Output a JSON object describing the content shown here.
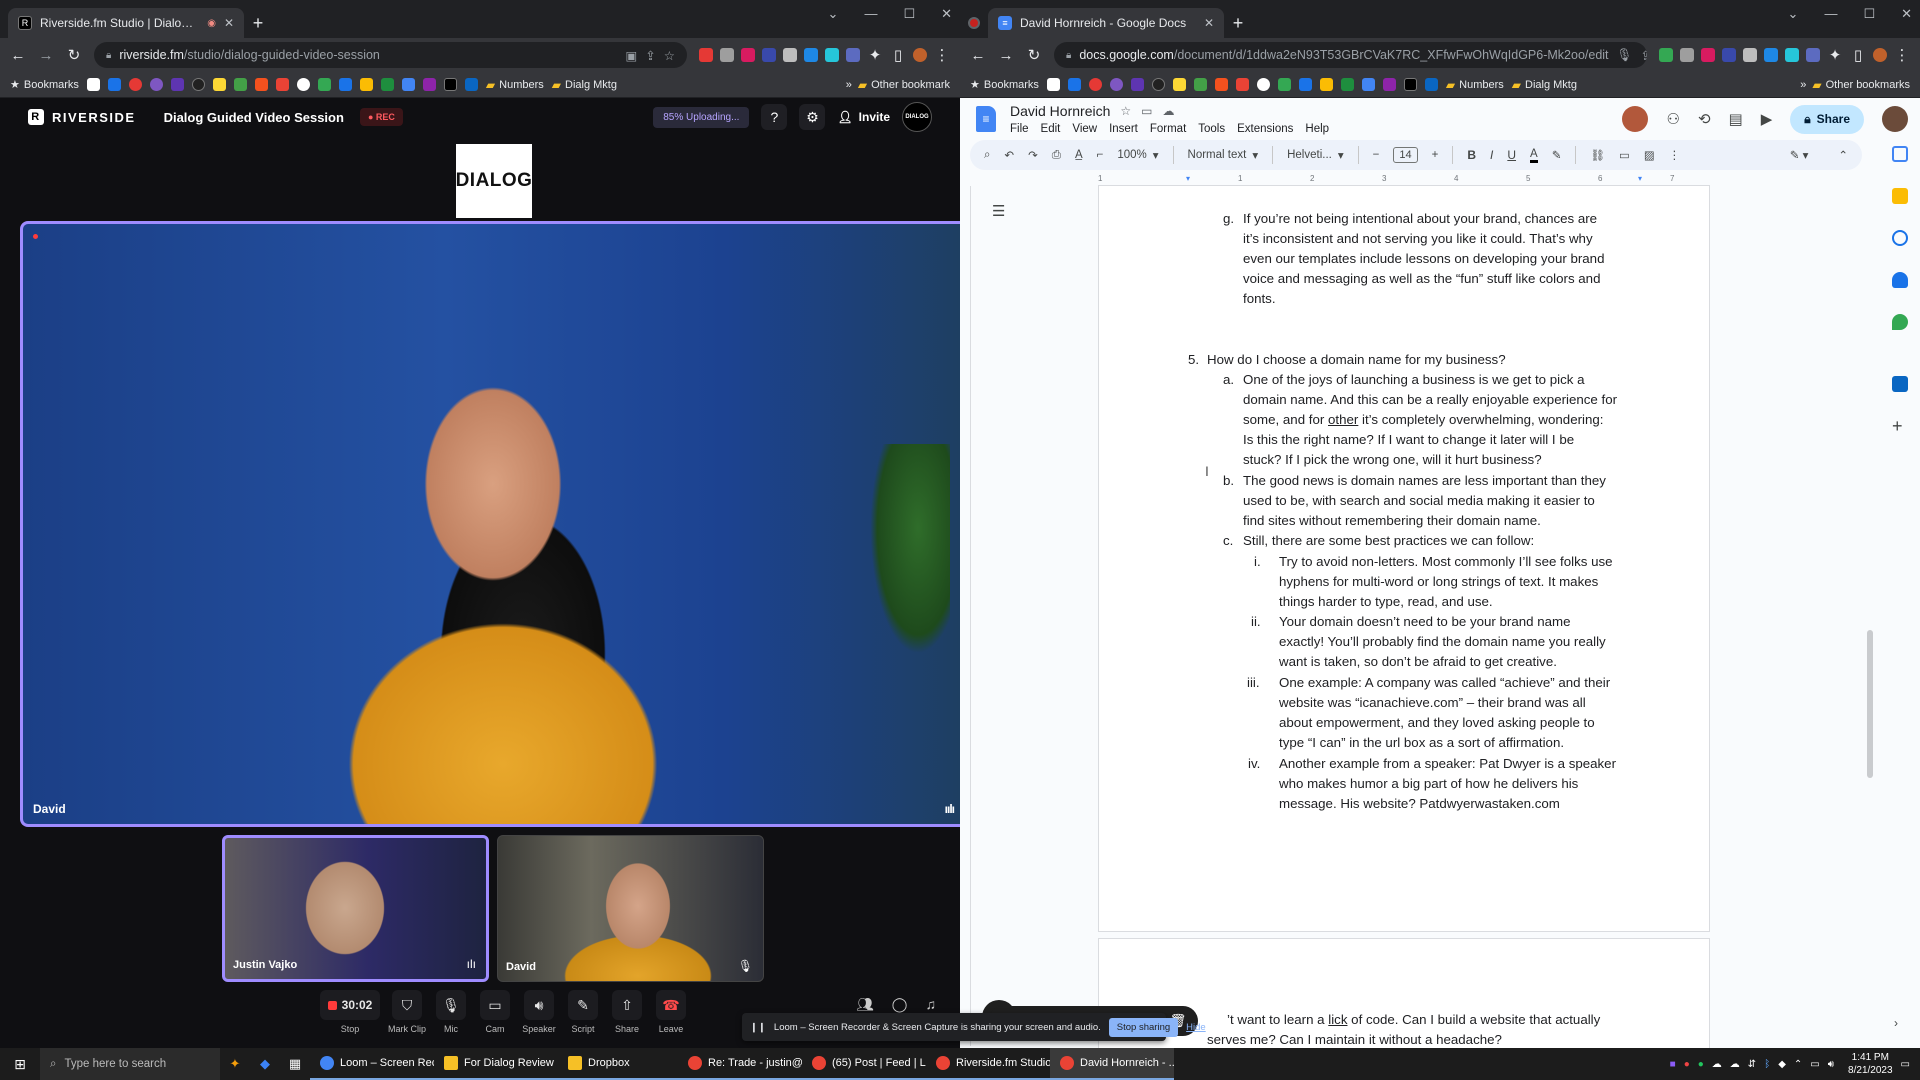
{
  "left_browser": {
    "tab_title": "Riverside.fm Studio | Dialog G",
    "url_host": "riverside.fm",
    "url_path": "/studio/dialog-guided-video-session",
    "bookmarks_label": "Bookmarks",
    "bookmark_numbers": "Numbers",
    "bookmark_dialg": "Dialg Mktg",
    "bookmark_other": "Other bookmark"
  },
  "riverside": {
    "logo_text": "RIVERSIDE",
    "session_title": "Dialog Guided Video Session",
    "rec_badge": "● REC",
    "upload_status": "85% Uploading...",
    "invite_label": "Invite",
    "avatar_text": "DIALOG",
    "brand_logo": "DIALOG",
    "main_speaker": "David",
    "participants": [
      {
        "name": "Justin Vajko"
      },
      {
        "name": "David"
      }
    ],
    "timer": "30:02",
    "controls": {
      "stop": "Stop",
      "mark_clip": "Mark Clip",
      "mic": "Mic",
      "cam": "Cam",
      "speaker": "Speaker",
      "script": "Script",
      "share": "Share",
      "leave": "Leave"
    }
  },
  "loom": {
    "message": "Loom – Screen Recorder & Screen Capture is sharing your screen and audio.",
    "stop_sharing": "Stop sharing",
    "hide": "Hide"
  },
  "right_browser": {
    "tab_title": "David Hornreich - Google Docs",
    "url_host": "docs.google.com",
    "url_path": "/document/d/1ddwa2eN93T53GBrCVaK7RC_XFfwFwOhWqIdGP6-Mk2oo/edit",
    "bookmarks_label": "Bookmarks",
    "bookmark_numbers": "Numbers",
    "bookmark_dialg": "Dialg Mktg",
    "bookmark_other": "Other bookmarks"
  },
  "docs": {
    "title": "David Hornreich",
    "menu": [
      "File",
      "Edit",
      "View",
      "Insert",
      "Format",
      "Tools",
      "Extensions",
      "Help"
    ],
    "share_label": "Share",
    "zoom": "100%",
    "style": "Normal text",
    "font": "Helveti...",
    "font_size": "14",
    "content": {
      "g_marker": "g.",
      "g_lines": [
        "If you’re not being intentional about your brand, chances are",
        "it’s inconsistent and not serving you like it could. That’s why",
        "even our templates include lessons on developing your brand",
        "voice and messaging as well as the “fun” stuff like colors and",
        "fonts."
      ],
      "q5_marker": "5.",
      "q5": "How do I choose a domain name for my business?",
      "a_marker": "a.",
      "a_lines": [
        "One of the joys of launching a business is we get to pick a",
        "domain name. And this can be a really enjoyable experience for",
        "some, and for",
        "other",
        " it’s completely overwhelming, wondering:",
        "Is this the right name? If I want to change it later will I be",
        "stuck? If I pick the wrong one, will it hurt business?"
      ],
      "b_marker": "b.",
      "b_lines": [
        "The good news is domain names are less important than they",
        "used to be, with search and social media making it easier to",
        "find sites without remembering their domain name."
      ],
      "c_marker": "c.",
      "c_line": "Still, there are some best practices we can follow:",
      "roman": [
        {
          "marker": "i.",
          "lines": [
            "Try to avoid non-letters. Most commonly I’ll see folks use",
            "hyphens for multi-word or long strings of text. It makes",
            "things harder to type, read, and use."
          ]
        },
        {
          "marker": "ii.",
          "lines": [
            "Your domain doesn’t need to be your brand name",
            "exactly! You’ll probably find the domain name you really",
            "want is taken, so don’t be afraid to get creative."
          ]
        },
        {
          "marker": "iii.",
          "lines": [
            "One example: A company was called “achieve” and their",
            "website was “icanachieve.com” – their brand was all",
            "about empowerment, and they loved asking people to",
            "type “I can” in the url box as a sort of affirmation."
          ]
        },
        {
          "marker": "iv.",
          "lines": [
            "Another example from a speaker: Pat Dwyer is a speaker",
            "who makes humor a big part of how he delivers his",
            "message. His website? Patdwyerwastaken.com"
          ]
        }
      ],
      "page2_line1_pre": "’t want to learn a ",
      "page2_line1_link": "lick",
      "page2_line1_post": " of code. Can I build a website that actually",
      "page2_line2": "serves me? Can I maintain it without a headache?"
    }
  },
  "taskbar": {
    "search_placeholder": "Type here to search",
    "apps": [
      "Loom – Screen Rec...",
      "For Dialog Review",
      "Dropbox",
      "Re: Trade - justin@...",
      "(65) Post | Feed | Li...",
      "Riverside.fm Studio...",
      "David Hornreich - ..."
    ],
    "time": "1:41 PM",
    "date": "8/21/2023"
  }
}
